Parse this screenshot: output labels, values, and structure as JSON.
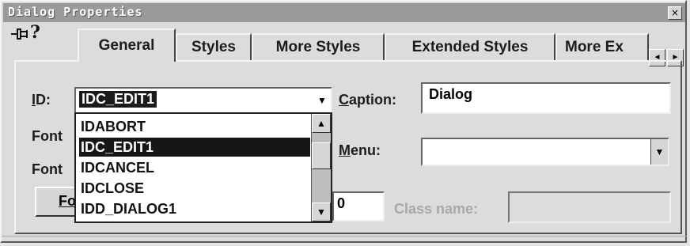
{
  "window": {
    "title": "Dialog Properties",
    "close_glyph": "×"
  },
  "toolbar": {
    "pin_icon": "pushpin-icon",
    "help_glyph": "?"
  },
  "tabs": [
    {
      "label": "General"
    },
    {
      "label": "Styles"
    },
    {
      "label": "More Styles"
    },
    {
      "label": "Extended Styles"
    },
    {
      "label": "More Ex"
    }
  ],
  "tab_scroll": {
    "left": "◄",
    "right": "►"
  },
  "general": {
    "id_label_first": "I",
    "id_label_rest": "D:",
    "id_value": "IDC_EDIT1",
    "caption_label_first": "C",
    "caption_label_rest": "aption:",
    "caption_value": "Dialog",
    "font_name_label": "Font",
    "font_size_label": "Font",
    "menu_label_first": "M",
    "menu_label_rest": "enu:",
    "menu_value": "",
    "font_button_label_first": "Fo",
    "xpos_value": "0",
    "class_name_label": "Class name:",
    "class_name_value": ""
  },
  "dropdown": {
    "items": [
      "IDABORT",
      "IDC_EDIT1",
      "IDCANCEL",
      "IDCLOSE",
      "IDD_DIALOG1"
    ],
    "selected": "IDC_EDIT1"
  }
}
